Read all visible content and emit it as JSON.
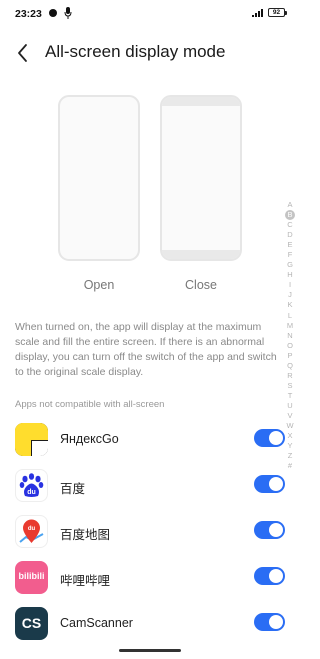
{
  "status_bar": {
    "time": "23:23",
    "battery": "92"
  },
  "header": {
    "title": "All-screen display mode"
  },
  "preview": {
    "open_label": "Open",
    "close_label": "Close"
  },
  "description": "When turned on, the app will display at the maximum scale and fill the entire screen. If there is an abnormal display, you can turn off the switch of the app and switch to the original scale display.",
  "section_header": "Apps not compatible with all-screen",
  "apps": [
    {
      "name": "ЯндексGo",
      "icon": "yandex-go-icon",
      "enabled": true
    },
    {
      "name": "百度",
      "icon": "baidu-icon",
      "enabled": true
    },
    {
      "name": "百度地图",
      "icon": "baidu-maps-icon",
      "enabled": true
    },
    {
      "name": "哔哩哔哩",
      "icon": "bilibili-icon",
      "enabled": true
    },
    {
      "name": "CamScanner",
      "icon": "camscanner-icon",
      "enabled": true
    }
  ],
  "icon_text": {
    "bilibili": "bilibili",
    "camscanner": "CS",
    "baidu": "du"
  },
  "alphabet_index": [
    "A",
    "B",
    "C",
    "D",
    "E",
    "F",
    "G",
    "H",
    "I",
    "J",
    "K",
    "L",
    "M",
    "N",
    "O",
    "P",
    "Q",
    "R",
    "S",
    "T",
    "U",
    "V",
    "W",
    "X",
    "Y",
    "Z",
    "#"
  ],
  "alphabet_active": "B",
  "colors": {
    "accent": "#2a6df4",
    "muted_text": "#8a8a8a"
  }
}
